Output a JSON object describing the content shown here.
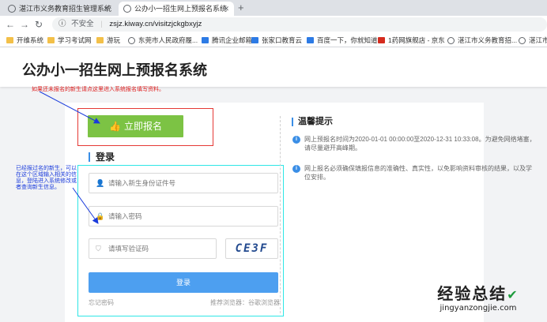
{
  "browser": {
    "tabs": [
      {
        "title": "湛江市义务教育招生管理系统",
        "active": false
      },
      {
        "title": "公办小一招生网上预报名系统",
        "active": true
      }
    ],
    "new_tab": "+",
    "address": {
      "security": "不安全",
      "url": "zsjz.kiway.cn/visitzjckgbxyjz"
    },
    "bookmarks": [
      "开维系统",
      "学习考试网",
      "游玩",
      "东莞市人民政府履...",
      "腾讯企业邮箱",
      "张家口教育云",
      "百度一下，你就知道",
      "1药网旗舰店 - 京东",
      "湛江市义务教育招...",
      "湛江市"
    ]
  },
  "page": {
    "title": "公办小一招生网上预报名系统",
    "signup_label": "立即报名",
    "login": {
      "title": "登录",
      "id_placeholder": "请输入新生身份证件号",
      "password_placeholder": "请输入密码",
      "captcha_placeholder": "请填写验证码",
      "captcha_text": "CE3F",
      "login_button": "登录",
      "forgot": "忘记密码",
      "recommended_browsers": "推荐浏览器：谷歌浏览器"
    },
    "tips": {
      "title": "温馨提示",
      "items": [
        "网上预报名时间为2020-01-01 00:00:00至2020-12-31 10:33:08。为避免网络堵塞，请尽量避开高峰期。",
        "网上报名必须确保填报信息的准确性、真实性，以免影响资料审核的结果，以及学位安排。"
      ]
    }
  },
  "annotations": {
    "top": "如果还未报名的新生请点这里进入系统报名填写资料。",
    "left": "已经报过名的新生，可以在这个区域输入相关的信息，登陆进入系统修改或者查询新生信息。"
  },
  "watermark": {
    "text": "经验总结",
    "url": "jingyanzongjie.com"
  },
  "colors": {
    "signup_green": "#7cc344",
    "login_blue": "#4d9ff0",
    "annot_red": "#e53935",
    "annot_cyan": "#2ee6e6"
  }
}
